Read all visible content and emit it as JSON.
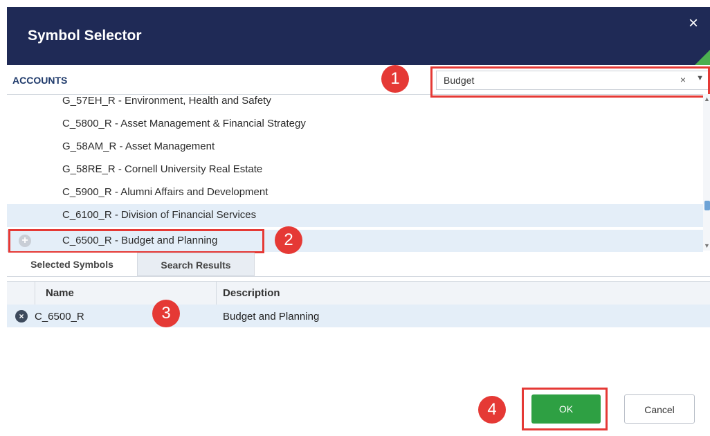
{
  "dialog": {
    "title": "Symbol Selector",
    "close_glyph": "×"
  },
  "accounts": {
    "label": "ACCOUNTS",
    "search_value": "Budget",
    "clear_glyph": "×",
    "dropdown_glyph": "▼"
  },
  "list": {
    "items": [
      {
        "label": "G_57EH_R - Environment, Health and Safety"
      },
      {
        "label": "C_5800_R - Asset Management & Financial Strategy"
      },
      {
        "label": "G_58AM_R - Asset Management"
      },
      {
        "label": "G_58RE_R - Cornell University Real Estate"
      },
      {
        "label": "C_5900_R - Alumni Affairs and Development"
      },
      {
        "label": "C_6100_R - Division of Financial Services"
      },
      {
        "label": "C_6500_R - Budget and Planning"
      }
    ],
    "add_glyph": "+"
  },
  "tabs": {
    "selected": "Selected Symbols",
    "search": "Search Results"
  },
  "table": {
    "headers": {
      "name": "Name",
      "description": "Description"
    },
    "rows": [
      {
        "name": "C_6500_R",
        "description": "Budget and Planning"
      }
    ],
    "remove_glyph": "×"
  },
  "buttons": {
    "ok": "OK",
    "cancel": "Cancel"
  },
  "annotations": [
    "1",
    "2",
    "3",
    "4"
  ],
  "colors": {
    "header_bg": "#1f2a56",
    "highlight": "#e53935",
    "ok_green": "#2ea043"
  }
}
